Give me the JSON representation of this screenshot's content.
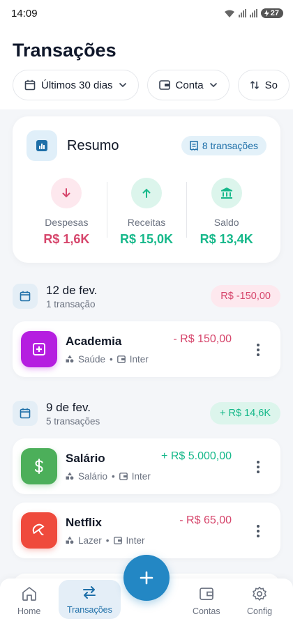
{
  "status": {
    "time": "14:09",
    "battery": "27"
  },
  "page": {
    "title": "Transações"
  },
  "filters": [
    {
      "label": "Últimos 30 dias"
    },
    {
      "label": "Conta"
    },
    {
      "label": "So"
    }
  ],
  "summary": {
    "title": "Resumo",
    "count": "8 transações",
    "expenses": {
      "label": "Despesas",
      "value": "R$ 1,6K"
    },
    "income": {
      "label": "Receitas",
      "value": "R$ 15,0K"
    },
    "balance": {
      "label": "Saldo",
      "value": "R$ 13,4K"
    }
  },
  "groups": [
    {
      "date": "12 de fev.",
      "count": "1 transação",
      "total": "R$ -150,00"
    },
    {
      "date": "9 de fev.",
      "count": "5 transações",
      "total": "+ R$ 14,6K"
    }
  ],
  "transactions": [
    {
      "name": "Academia",
      "amount": "- R$  150,00",
      "category": "Saúde",
      "account": "Inter"
    },
    {
      "name": "Salário",
      "amount": "+ R$  5.000,00",
      "category": "Salário",
      "account": "Inter"
    },
    {
      "name": "Netflix",
      "amount": "- R$  65,00",
      "category": "Lazer",
      "account": "Inter"
    }
  ],
  "nav": {
    "home": "Home",
    "transactions": "Transações",
    "accounts": "Contas",
    "config": "Config"
  },
  "colors": {
    "primary": "#2387c4",
    "expense": "#d6456b",
    "income": "#16b88a",
    "academia": "#b51ee0",
    "salario": "#4caf5a",
    "netflix": "#ef4a3c"
  }
}
